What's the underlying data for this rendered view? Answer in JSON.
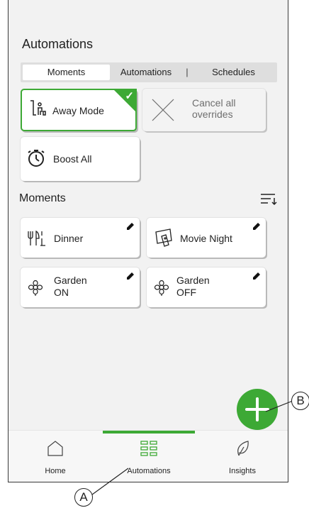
{
  "header": {
    "title": "Automations"
  },
  "tabs": [
    {
      "label": "Moments",
      "active": true
    },
    {
      "label": "Automations",
      "active": false
    },
    {
      "label": "Schedules",
      "active": false
    }
  ],
  "tab_separator": "|",
  "automations": {
    "away_mode": {
      "label": "Away Mode",
      "selected": true,
      "icon": "away-person-icon"
    },
    "cancel_overrides": {
      "label_line1": "Cancel all",
      "label_line2": "overrides",
      "icon": "x-icon"
    },
    "boost_all": {
      "label": "Boost All",
      "icon": "timer-icon"
    }
  },
  "moments_section": {
    "title": "Moments",
    "sort_icon": "sort-icon"
  },
  "moments": [
    {
      "line1": "Dinner",
      "line2": "",
      "icon": "cutlery-icon"
    },
    {
      "line1": "Movie Night",
      "line2": "",
      "icon": "tv-remote-icon"
    },
    {
      "line1": "Garden",
      "line2": "ON",
      "icon": "flower-icon"
    },
    {
      "line1": "Garden",
      "line2": "OFF",
      "icon": "flower-icon"
    }
  ],
  "bottom_nav": [
    {
      "label": "Home",
      "icon": "home-icon",
      "active": false
    },
    {
      "label": "Automations",
      "icon": "grid-icon",
      "active": true
    },
    {
      "label": "Insights",
      "icon": "leaf-icon",
      "active": false
    }
  ],
  "callouts": {
    "a": "A",
    "b": "B"
  },
  "colors": {
    "accent": "#3da935",
    "background": "#f2f2f2",
    "card": "#ffffff"
  }
}
